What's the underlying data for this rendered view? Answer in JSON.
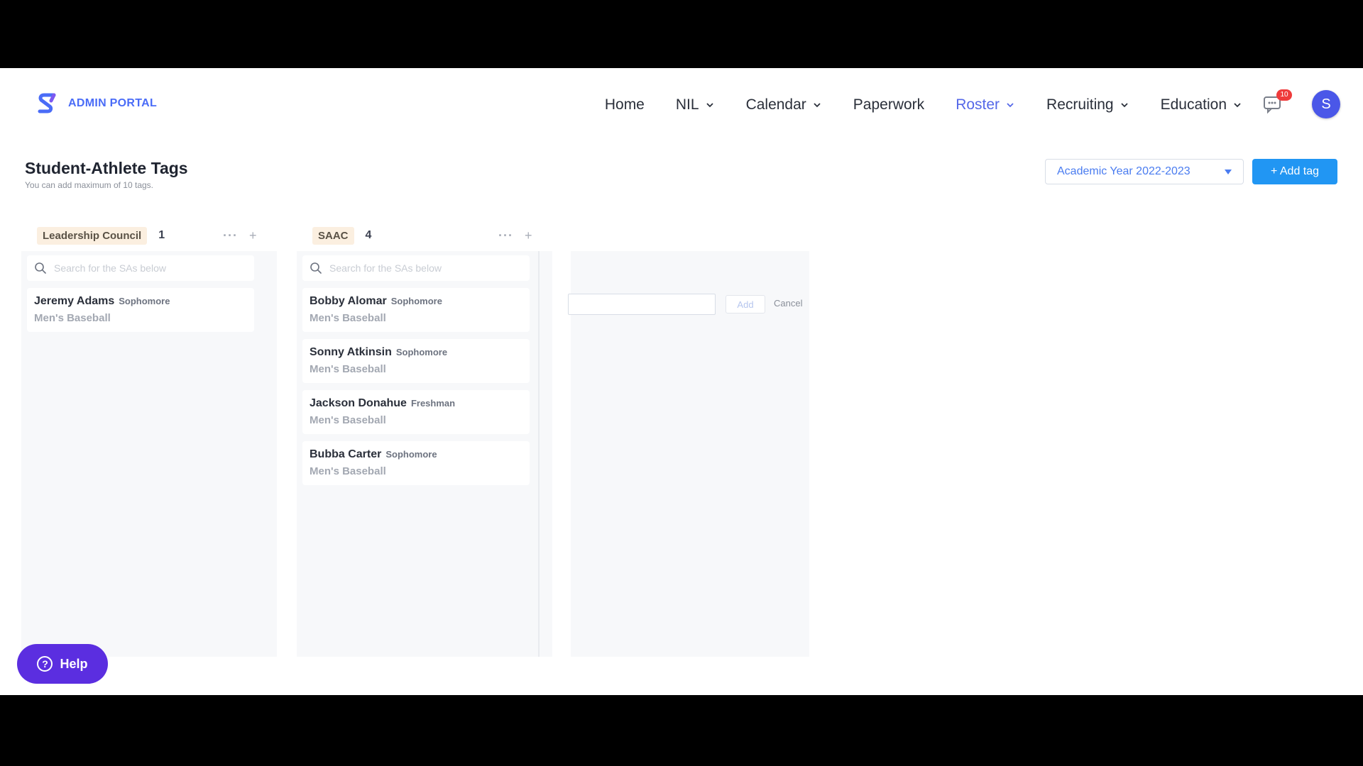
{
  "app": {
    "brand_name": "ADMIN PORTAL",
    "brand_color": "#4a6cf7"
  },
  "nav": {
    "items": [
      {
        "label": "Home",
        "has_dropdown": false
      },
      {
        "label": "NIL",
        "has_dropdown": true
      },
      {
        "label": "Calendar",
        "has_dropdown": true
      },
      {
        "label": "Paperwork",
        "has_dropdown": false
      },
      {
        "label": "Roster",
        "has_dropdown": true,
        "active": true
      },
      {
        "label": "Recruiting",
        "has_dropdown": true
      },
      {
        "label": "Education",
        "has_dropdown": true
      }
    ],
    "notifications_icon": "chat-bubble-icon",
    "notification_count": "10",
    "avatar_initial": "S"
  },
  "page": {
    "title": "Student-Athlete Tags",
    "subtitle": "You can add maximum of 10 tags.",
    "academic_year": "Academic Year 2022-2023",
    "add_tag_label": "+ Add tag"
  },
  "columns": [
    {
      "tag": "Leadership Council",
      "count": "1",
      "search_placeholder": "Search for the SAs below",
      "members": [
        {
          "name": "Jeremy Adams",
          "year": "Sophomore",
          "sport": "Men's Baseball"
        }
      ]
    },
    {
      "tag": "SAAC",
      "count": "4",
      "search_placeholder": "Search for the SAs below",
      "members": [
        {
          "name": "Bobby Alomar",
          "year": "Sophomore",
          "sport": "Men's Baseball"
        },
        {
          "name": "Sonny Atkinsin",
          "year": "Sophomore",
          "sport": "Men's Baseball"
        },
        {
          "name": "Jackson Donahue",
          "year": "Freshman",
          "sport": "Men's Baseball"
        },
        {
          "name": "Bubba Carter",
          "year": "Sophomore",
          "sport": "Men's Baseball"
        }
      ]
    }
  ],
  "new_tag": {
    "input_value": "",
    "add_label": "Add",
    "cancel_label": "Cancel"
  },
  "help": {
    "label": "Help"
  }
}
